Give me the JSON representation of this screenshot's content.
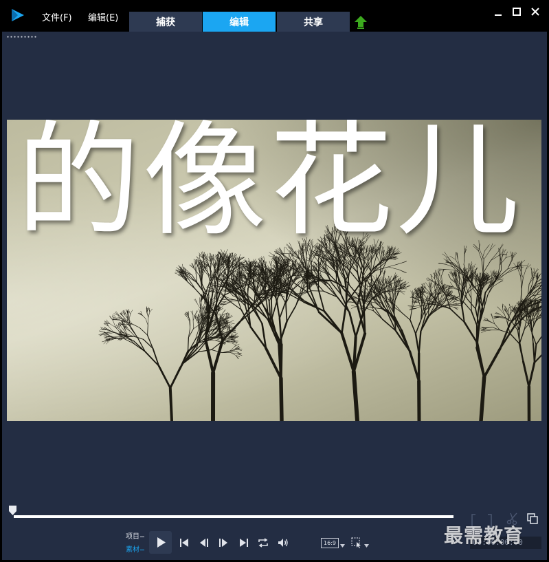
{
  "menu": {
    "file": "文件(F)",
    "edit": "编辑(E)"
  },
  "tabs": {
    "capture": "捕获",
    "edit": "编辑",
    "share": "共享",
    "active": "编辑"
  },
  "preview": {
    "title_text": "的像花儿"
  },
  "playback": {
    "mode_project": "项目",
    "mode_clip": "素材",
    "active_mode": "素材",
    "aspect_ratio": "16:9",
    "timecode": "00:00:00:00",
    "progress": 0
  },
  "watermark": "最需教育",
  "colors": {
    "accent": "#1ba6f2",
    "panel": "#232d43",
    "tab": "#2e3a52",
    "upload": "#3caa1e"
  },
  "icons": {
    "logo": "app-logo-icon",
    "upload": "upload-icon",
    "minimize": "minimize-icon",
    "maximize": "maximize-icon",
    "close": "close-icon",
    "play": "play-icon",
    "start": "go-to-start-icon",
    "prev": "previous-frame-icon",
    "next": "next-frame-icon",
    "end": "go-to-end-icon",
    "repeat": "repeat-icon",
    "volume": "volume-icon",
    "crop": "crop-icon",
    "scissors": "scissors-icon",
    "copy": "copy-icon"
  }
}
